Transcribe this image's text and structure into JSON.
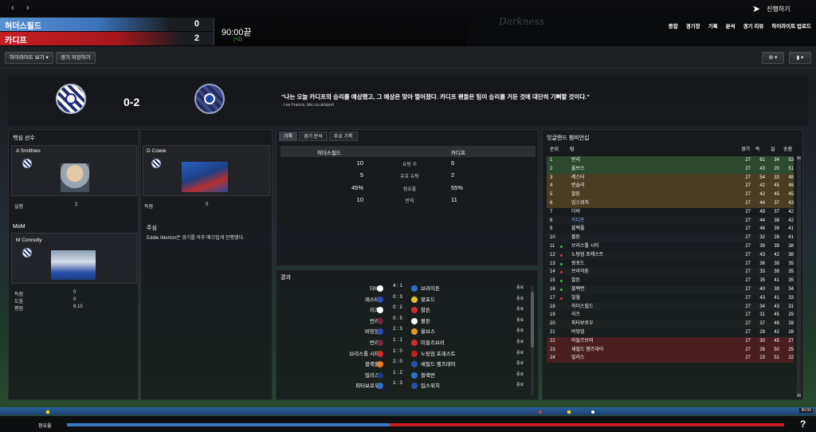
{
  "nav": {
    "back": "‹",
    "forward": "›"
  },
  "scoreboard": {
    "home": {
      "name": "허더스필드",
      "goals": "0"
    },
    "away": {
      "name": "카디프",
      "goals": "2"
    },
    "time": "90:00끝",
    "extra": "(+2)"
  },
  "brand": "Darkness",
  "proceed_label": "진행하기",
  "menu": [
    "종합",
    "경기장",
    "기록",
    "분석",
    "경기 리뷰",
    "하이라이트 업로드"
  ],
  "toolbar": {
    "highlights_label": "하이라이트 보기",
    "save_label": "경기 저장하기"
  },
  "header": {
    "scoreline": "0-2",
    "quote": "\"나는 오늘 카디프의 승리를 예상했고, 그 예상은 맞아 떨어졌다. 카디프 팬들은 팀이 승리를 거둔 것에 대단히 기뻐할 것이다.\"",
    "quote_source": "- Lee Francis, bbc.co.uk/sport"
  },
  "key_players": {
    "title": "핵심 선수",
    "home": {
      "name": "A Smithies",
      "stat_label": "실점",
      "stat_value": "2"
    },
    "away": {
      "name": "D Cowie",
      "stat_label": "득점",
      "stat_value": "0"
    }
  },
  "mom": {
    "title": "MoM",
    "name": "M Connolly",
    "stats": [
      {
        "label": "득점",
        "value": "0"
      },
      {
        "label": "도움",
        "value": "0"
      },
      {
        "label": "평점",
        "value": "8.10"
      }
    ]
  },
  "notes": {
    "title": "주심",
    "text": "Eddie Ilderton은 경기를 아주 매끄럽게 진행했다."
  },
  "stats_panel": {
    "tabs": [
      "기록",
      "경기 분석",
      "주요 기록"
    ],
    "home_header": "허더스필드",
    "away_header": "카디프",
    "rows": [
      {
        "label": "슈팅 수",
        "home": "10",
        "away": "6"
      },
      {
        "label": "유효 슈팅",
        "home": "5",
        "away": "2"
      },
      {
        "label": "점유율",
        "home": "45%",
        "away": "55%"
      },
      {
        "label": "반칙",
        "home": "10",
        "away": "11"
      }
    ]
  },
  "results": {
    "title": "결과",
    "rows": [
      {
        "home": "더비",
        "score": "4 : 1",
        "away": "브라이튼",
        "status": "종료",
        "hc": "#ffffff",
        "ac": "#2f6fd0"
      },
      {
        "home": "레스터",
        "score": "0 : 3",
        "away": "왓포드",
        "status": "종료",
        "hc": "#2b4fb0",
        "ac": "#e8c320"
      },
      {
        "home": "리즈",
        "score": "0 : 2",
        "away": "찰튼",
        "status": "종료",
        "hc": "#ffffff",
        "ac": "#d22a2a"
      },
      {
        "home": "번리",
        "score": "0 : 5",
        "away": "볼튼",
        "status": "종료",
        "hc": "#7a2338",
        "ac": "#ffffff"
      },
      {
        "home": "버밍엄",
        "score": "2 : 3",
        "away": "울브스",
        "status": "종료",
        "hc": "#2b4fb0",
        "ac": "#e89a20"
      },
      {
        "home": "번리",
        "score": "1 : 1",
        "away": "미들즈브러",
        "status": "종료",
        "hc": "#7a2338",
        "ac": "#d22a2a"
      },
      {
        "home": "브리스톨 시티",
        "score": "1 : 0",
        "away": "노팅엄 포레스트",
        "status": "종료",
        "hc": "#d22a2a",
        "ac": "#c81e1e"
      },
      {
        "home": "블랙풀",
        "score": "2 : 0",
        "away": "셰필드 웬즈데이",
        "status": "종료",
        "hc": "#f07a1a",
        "ac": "#2b4fb0"
      },
      {
        "home": "밀리스",
        "score": "1 : 2",
        "away": "블랙번",
        "status": "종료",
        "hc": "#1e3a8a",
        "ac": "#2f6fd0"
      },
      {
        "home": "피터보로우",
        "score": "1 : 3",
        "away": "입스위치",
        "status": "종료",
        "hc": "#2f6fd0",
        "ac": "#2b4fb0"
      }
    ]
  },
  "league": {
    "title": "잉글랜드 챔피언십",
    "headers": {
      "pos": "순위",
      "team": "팀",
      "played": "경기",
      "won": "득",
      "lost": "실",
      "points": "승점"
    },
    "rows": [
      {
        "pos": "1",
        "team": "번리",
        "p": "27",
        "a": "61",
        "b": "34",
        "pts": "53",
        "move": "",
        "zone": "promo"
      },
      {
        "pos": "2",
        "team": "울브스",
        "p": "27",
        "a": "43",
        "b": "20",
        "pts": "51",
        "move": "",
        "zone": "promo"
      },
      {
        "pos": "3",
        "team": "레스터",
        "p": "27",
        "a": "54",
        "b": "33",
        "pts": "48",
        "move": "",
        "zone": "playoff"
      },
      {
        "pos": "4",
        "team": "번슬리",
        "p": "27",
        "a": "42",
        "b": "45",
        "pts": "46",
        "move": "",
        "zone": "playoff"
      },
      {
        "pos": "5",
        "team": "찰튼",
        "p": "27",
        "a": "42",
        "b": "45",
        "pts": "45",
        "move": "",
        "zone": "playoff"
      },
      {
        "pos": "6",
        "team": "입스위치",
        "p": "27",
        "a": "44",
        "b": "37",
        "pts": "43",
        "move": "",
        "zone": "playoff"
      },
      {
        "pos": "7",
        "team": "더비",
        "p": "27",
        "a": "49",
        "b": "37",
        "pts": "42",
        "move": "",
        "zone": ""
      },
      {
        "pos": "8",
        "team": "카디프",
        "p": "27",
        "a": "44",
        "b": "38",
        "pts": "42",
        "move": "",
        "zone": "",
        "highlight": true
      },
      {
        "pos": "9",
        "team": "블랙풀",
        "p": "27",
        "a": "48",
        "b": "39",
        "pts": "41",
        "move": "",
        "zone": ""
      },
      {
        "pos": "10",
        "team": "볼튼",
        "p": "27",
        "a": "32",
        "b": "28",
        "pts": "41",
        "move": "",
        "zone": ""
      },
      {
        "pos": "11",
        "team": "브리스톨 시티",
        "p": "27",
        "a": "39",
        "b": "39",
        "pts": "38",
        "move": "up",
        "zone": ""
      },
      {
        "pos": "12",
        "team": "노팅엄 포레스트",
        "p": "27",
        "a": "43",
        "b": "42",
        "pts": "38",
        "move": "down",
        "zone": ""
      },
      {
        "pos": "13",
        "team": "왓포드",
        "p": "27",
        "a": "36",
        "b": "38",
        "pts": "35",
        "move": "up",
        "zone": ""
      },
      {
        "pos": "14",
        "team": "브라이튼",
        "p": "27",
        "a": "33",
        "b": "38",
        "pts": "35",
        "move": "down",
        "zone": ""
      },
      {
        "pos": "15",
        "team": "찰튼",
        "p": "27",
        "a": "35",
        "b": "41",
        "pts": "35",
        "move": "up",
        "zone": ""
      },
      {
        "pos": "16",
        "team": "블랙번",
        "p": "27",
        "a": "40",
        "b": "39",
        "pts": "34",
        "move": "up",
        "zone": ""
      },
      {
        "pos": "17",
        "team": "밀월",
        "p": "27",
        "a": "43",
        "b": "41",
        "pts": "33",
        "move": "down",
        "zone": ""
      },
      {
        "pos": "18",
        "team": "허더스필드",
        "p": "27",
        "a": "34",
        "b": "43",
        "pts": "31",
        "move": "",
        "zone": ""
      },
      {
        "pos": "19",
        "team": "리즈",
        "p": "27",
        "a": "31",
        "b": "45",
        "pts": "29",
        "move": "",
        "zone": ""
      },
      {
        "pos": "20",
        "team": "피터보로우",
        "p": "27",
        "a": "37",
        "b": "46",
        "pts": "28",
        "move": "",
        "zone": ""
      },
      {
        "pos": "21",
        "team": "버밍엄",
        "p": "27",
        "a": "29",
        "b": "42",
        "pts": "28",
        "move": "",
        "zone": ""
      },
      {
        "pos": "22",
        "team": "미들즈브러",
        "p": "27",
        "a": "30",
        "b": "45",
        "pts": "27",
        "move": "",
        "zone": "releg"
      },
      {
        "pos": "23",
        "team": "셰필드 웬즈데이",
        "p": "27",
        "a": "26",
        "b": "50",
        "pts": "25",
        "move": "",
        "zone": "releg"
      },
      {
        "pos": "24",
        "team": "밀리스",
        "p": "27",
        "a": "23",
        "b": "51",
        "pts": "22",
        "move": "",
        "zone": "releg"
      }
    ]
  },
  "bottom": {
    "possession_label": "점유율",
    "home_possession": 0.45,
    "timeline_end": "90:00",
    "help": "?"
  },
  "colors": {
    "home": "#3a78c8",
    "away": "#c81e25",
    "promo": "#2e4a2e",
    "playoff": "#4a3e22",
    "releg": "#4a1e20",
    "accent_green": "#6bd06b"
  }
}
